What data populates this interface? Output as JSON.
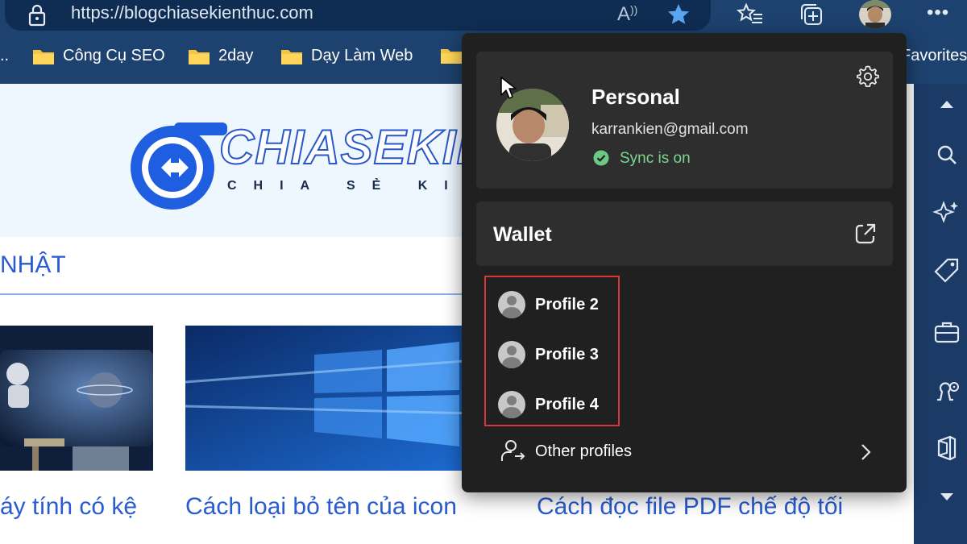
{
  "browser": {
    "url": "https://blogchiasekienthuc.com",
    "toolbar_icons": [
      "read-aloud-icon",
      "favorite-star-icon",
      "favorites-list-icon",
      "collections-icon",
      "profile-avatar",
      "more-icon"
    ],
    "read_aloud_glyph": "Ä́",
    "more_glyph": "•••"
  },
  "favorites_bar": {
    "items": [
      {
        "label": ".."
      },
      {
        "label": "Công Cụ SEO"
      },
      {
        "label": "2day"
      },
      {
        "label": "Dạy Làm Web"
      },
      {
        "label": ""
      },
      {
        "label": "Favorites"
      }
    ]
  },
  "page": {
    "logo_text": "CHIASEKIEN",
    "logo_sub": "CHIA SẺ KIẾN",
    "nav_fragment": "NHẬT",
    "titles": [
      "áy tính có kệ",
      "Cách loại bỏ tên của icon",
      "Cách đọc file PDF chế độ tối"
    ]
  },
  "profile_menu": {
    "personal": {
      "name": "Personal",
      "email": "karrankien@gmail.com",
      "sync": "Sync is on"
    },
    "wallet": "Wallet",
    "profiles": [
      "Profile 2",
      "Profile 3",
      "Profile 4"
    ],
    "other_profiles": "Other profiles"
  },
  "colors": {
    "accent_blue": "#2a5bd0",
    "flyout_bg": "#202020",
    "card_bg": "#2e2e2e",
    "sync_green": "#7bd88f",
    "highlight_red": "#d93636"
  }
}
